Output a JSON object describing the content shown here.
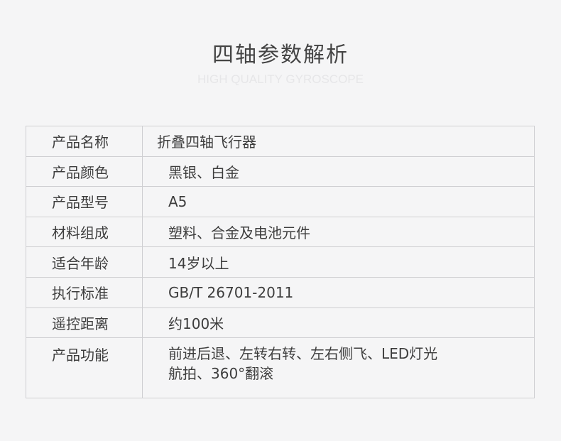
{
  "header": {
    "title": "四轴参数解析",
    "subtitle": "HIGH QUALITY GYROSCOPE"
  },
  "specs": [
    {
      "label": "产品名称",
      "value": "折叠四轴飞行器"
    },
    {
      "label": "产品颜色",
      "value": "黑银、白金"
    },
    {
      "label": "产品型号",
      "value": "A5"
    },
    {
      "label": "材料组成",
      "value": "塑料、合金及电池元件"
    },
    {
      "label": "适合年龄",
      "value": "14岁以上"
    },
    {
      "label": "执行标准",
      "value": "GB/T 26701-2011"
    },
    {
      "label": "遥控距离",
      "value": "约100米"
    },
    {
      "label": "产品功能",
      "value_lines": [
        "前进后退、左转右转、左右侧飞、LED灯光",
        "航拍、360°翻滚"
      ]
    }
  ],
  "colors": {
    "background": "#f5f5f6",
    "border": "#cfcfd2",
    "text": "#3d3d3d",
    "subtitle": "#e6e6e8"
  }
}
